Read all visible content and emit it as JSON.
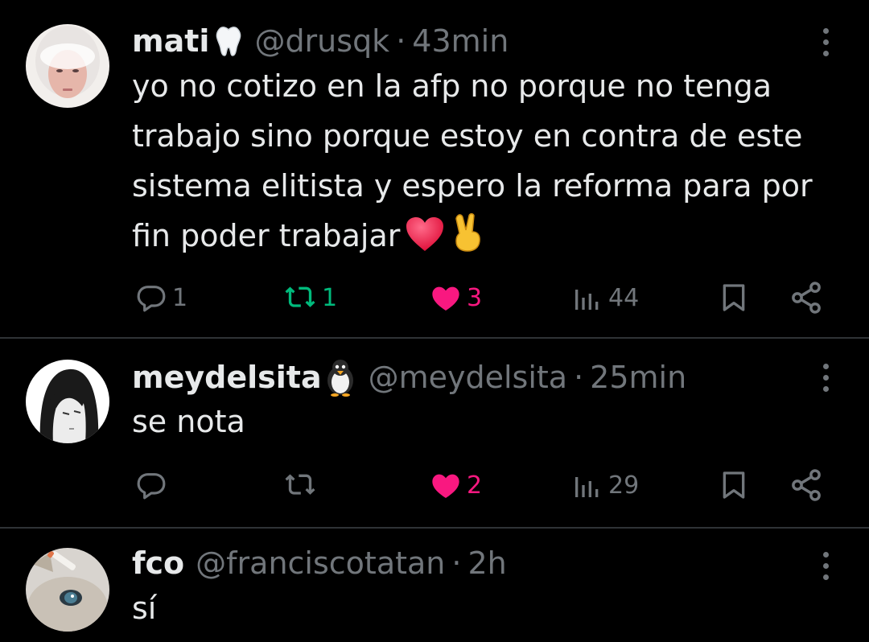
{
  "tweets": [
    {
      "display_name": "mati",
      "name_emoji": "tooth-emoji",
      "handle": "@drusqk",
      "separator": "·",
      "time": "43min",
      "text": "yo no cotizo en la afp no porque no tenga trabajo sino porque estoy en contra de este sistema elitista y espero la reforma para por fin poder trabajar",
      "text_emojis": [
        "red-heart-emoji",
        "victory-hand-emoji"
      ],
      "replies": "1",
      "reposts": "1",
      "likes": "3",
      "views": "44",
      "reposted": true,
      "liked": true
    },
    {
      "display_name": "meydelsita",
      "name_emoji": "penguin-emoji",
      "handle": "@meydelsita",
      "separator": "·",
      "time": "25min",
      "text": "se nota",
      "replies": "",
      "reposts": "",
      "likes": "2",
      "views": "29",
      "reposted": false,
      "liked": true
    },
    {
      "display_name": "fco",
      "handle": "@franciscotatan",
      "separator": "·",
      "time": "2h",
      "text": "sí"
    }
  ],
  "colors": {
    "background": "#000000",
    "text": "#e7e9ea",
    "muted": "#71767b",
    "like": "#f91880",
    "repost": "#00ba7c",
    "divider": "#2f3336"
  },
  "icons": [
    "reply-icon",
    "repost-icon",
    "like-icon",
    "views-icon",
    "bookmark-icon",
    "share-icon",
    "more-icon"
  ]
}
